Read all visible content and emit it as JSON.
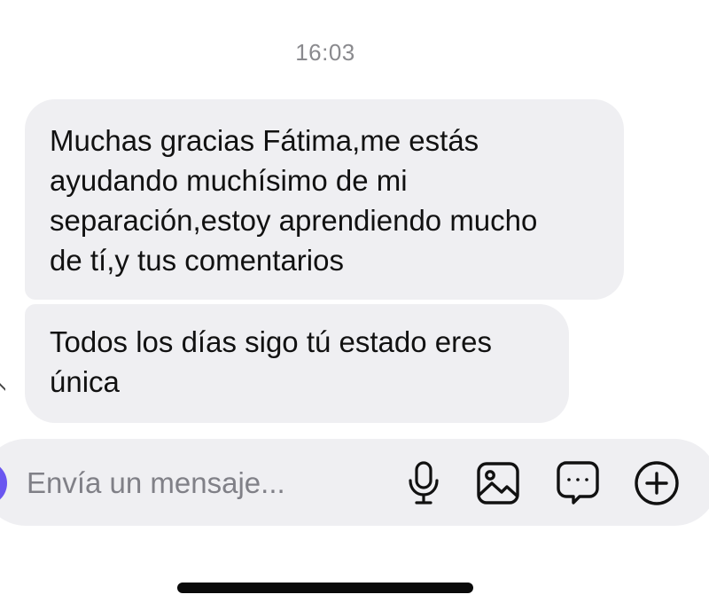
{
  "chat": {
    "timestamp": "16:03",
    "messages": [
      {
        "lines": [
          "Muchas gracias Fátima,me estás",
          "ayudando muchísimo de mi",
          "separación,estoy aprendiendo mucho",
          "de tí,y tus comentarios"
        ]
      },
      {
        "lines": [
          "Todos los días sigo tú estado eres",
          "única"
        ]
      }
    ]
  },
  "composer": {
    "placeholder": "Envía un mensaje...",
    "icons": {
      "mic": "microphone-icon",
      "gallery": "image-gallery-icon",
      "chat": "chat-bubble-icon",
      "plus": "plus-circle-icon"
    }
  },
  "colors": {
    "bubble_bg": "#efeff2",
    "composer_bg": "#efeff2",
    "timestamp": "#8a8a8e",
    "placeholder": "#808087",
    "avatar": "#6a56f0",
    "text": "#111111"
  }
}
